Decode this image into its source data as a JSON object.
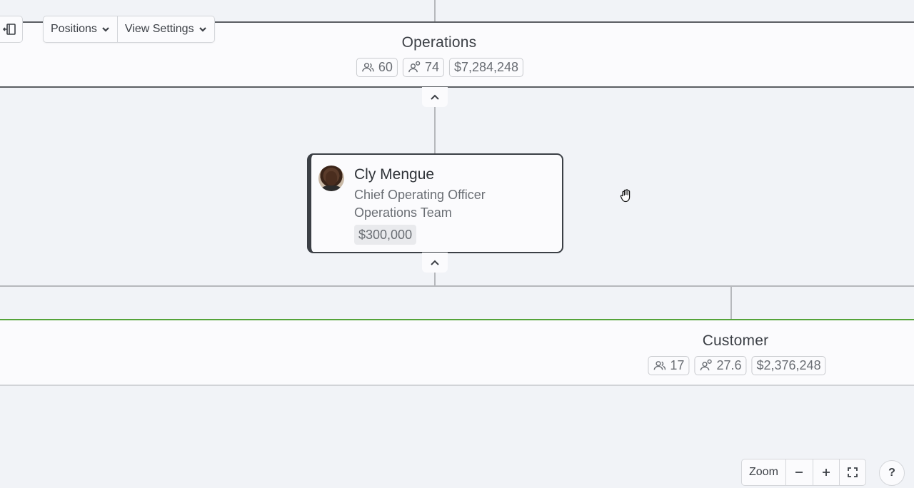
{
  "toolbar": {
    "positions_label": "Positions",
    "view_settings_label": "View Settings"
  },
  "departments": [
    {
      "name": "Operations",
      "headcount": "60",
      "positions": "74",
      "budget": "$7,284,248"
    },
    {
      "name": "Customer",
      "headcount": "17",
      "positions": "27.6",
      "budget": "$2,376,248"
    }
  ],
  "person": {
    "name": "Cly Mengue",
    "role": "Chief Operating Officer",
    "team": "Operations Team",
    "salary": "$300,000"
  },
  "zoom": {
    "label": "Zoom",
    "help_label": "?"
  },
  "colors": {
    "canvas": "#f1f3f7",
    "card": "#fbfbfd",
    "ops_border": "#5b5e63",
    "customer_accent": "#55a33a",
    "connector": "#b6b8bc"
  },
  "icons": [
    "sidebar-collapse-icon",
    "chevron-down-icon",
    "people-icon",
    "person-badge-icon",
    "chevron-up-icon",
    "minus-icon",
    "plus-icon",
    "fullscreen-icon",
    "hand-cursor-icon"
  ]
}
